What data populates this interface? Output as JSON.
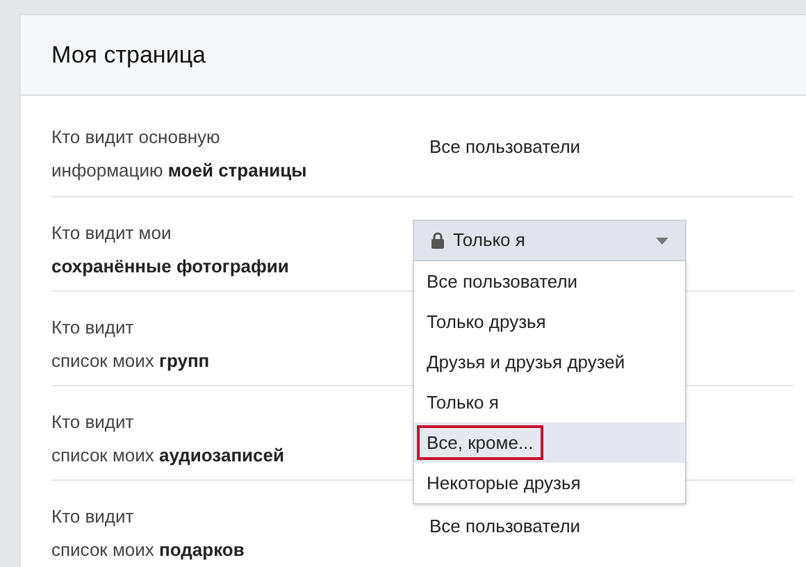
{
  "header": {
    "title": "Моя страница"
  },
  "rows": [
    {
      "kind": "text",
      "label": "Кто видит основную\nинформацию **моей страницы**",
      "value": "Все пользователи"
    },
    {
      "kind": "dropdown",
      "label": "Кто видит мои\n**сохранённые фотографии**",
      "value": "Только я",
      "expanded": true,
      "options": [
        {
          "label": "Все пользователи",
          "highlighted": false
        },
        {
          "label": "Только друзья",
          "highlighted": false
        },
        {
          "label": "Друзья и друзья друзей",
          "highlighted": false
        },
        {
          "label": "Только я",
          "highlighted": false
        },
        {
          "label": "Все, кроме...",
          "highlighted": true
        },
        {
          "label": "Некоторые друзья",
          "highlighted": false
        }
      ]
    },
    {
      "kind": "covered",
      "label": "Кто видит\nсписок моих **групп**"
    },
    {
      "kind": "covered",
      "label": "Кто видит\nсписок моих **аудиозаписей**"
    },
    {
      "kind": "text",
      "label": "Кто видит\nсписок моих **подарков**",
      "value": "Все пользователи"
    }
  ]
}
